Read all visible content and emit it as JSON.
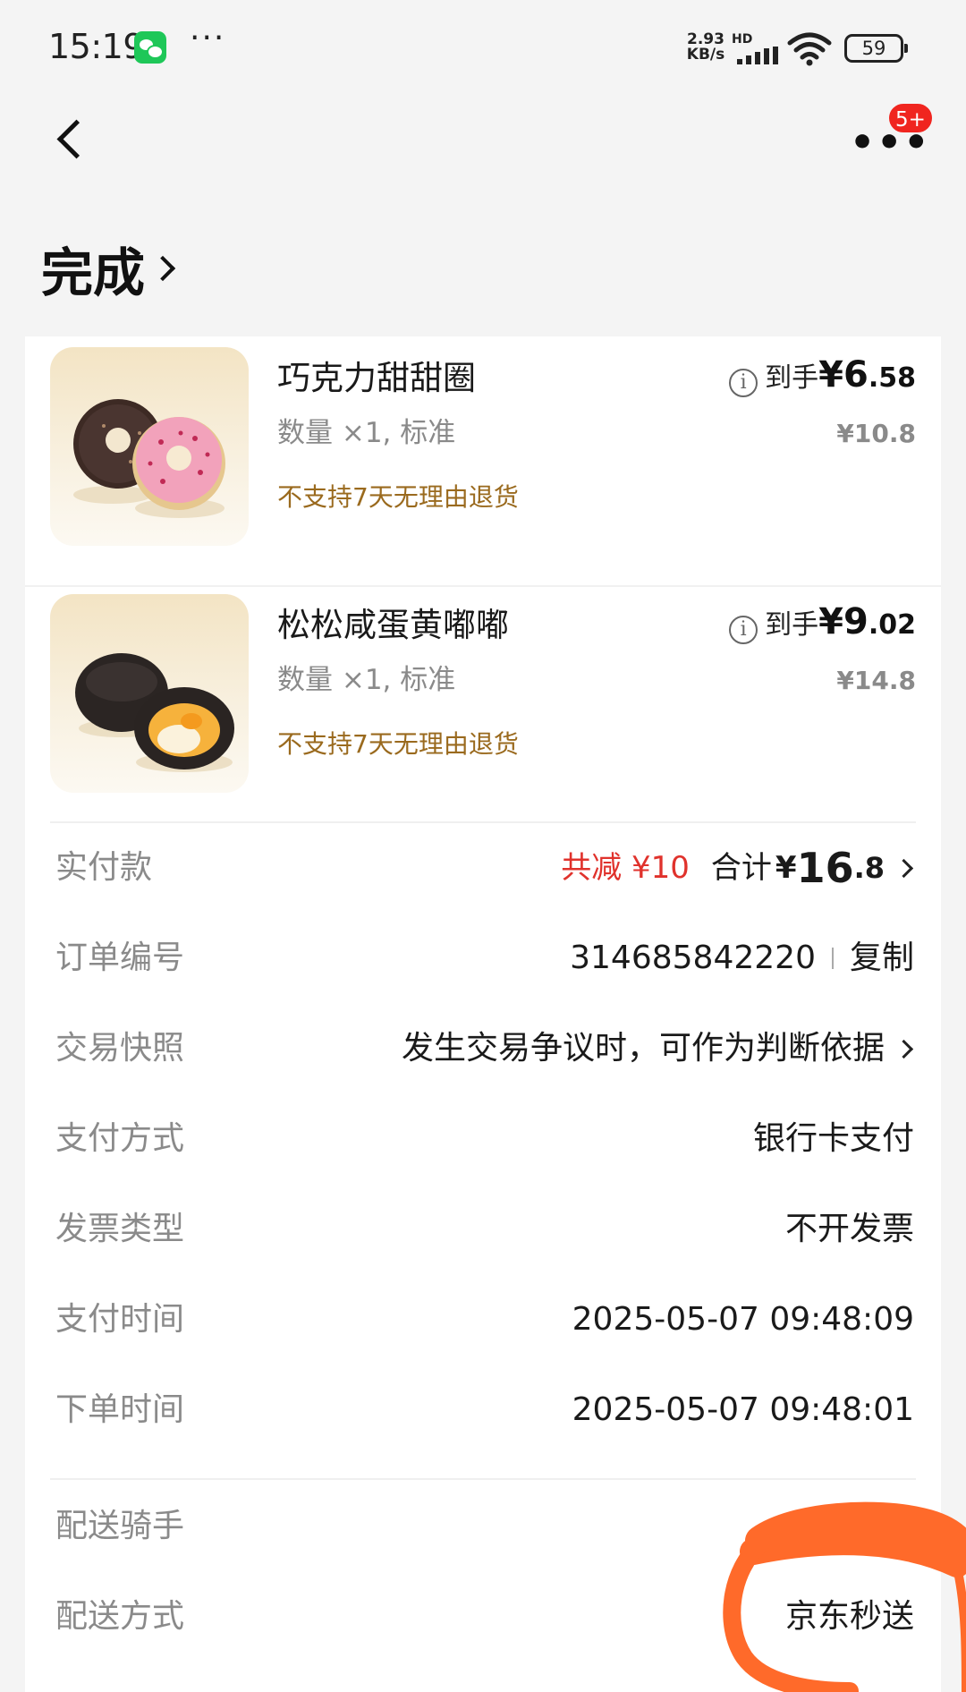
{
  "status_bar": {
    "time": "15:19",
    "speed": "2.93 KB/s",
    "network": "HD",
    "battery": "59",
    "icons": [
      "wechat-icon",
      "more-dots-icon",
      "signal-icon",
      "wifi-icon",
      "battery-icon"
    ]
  },
  "nav": {
    "more_label": "•••",
    "badge": "5+",
    "icons": [
      "back-arrow-icon",
      "more-icon"
    ]
  },
  "order": {
    "status": "完成"
  },
  "products": [
    {
      "name": "巧克力甜甜圈",
      "spec": "数量 ×1, 标准",
      "note": "不支持7天无理由退货",
      "price_label": "到手",
      "price_int": "¥6",
      "price_dec": ".58",
      "original_price": "¥10.8"
    },
    {
      "name": "松松咸蛋黄嘟嘟",
      "spec": "数量 ×1, 标准",
      "note": "不支持7天无理由退货",
      "price_label": "到手",
      "price_int": "¥9",
      "price_dec": ".02",
      "original_price": "¥14.8"
    }
  ],
  "payment": {
    "label": "实付款",
    "discount": "共减 ¥10",
    "total_label": "合计",
    "total_yen": "¥",
    "total_int": "16",
    "total_dec": ".8"
  },
  "details": {
    "order_no_label": "订单编号",
    "order_no": "314685842220",
    "copy": "复制",
    "snapshot_label": "交易快照",
    "snapshot_value": "发生交易争议时，可作为判断依据",
    "pay_method_label": "支付方式",
    "pay_method": "银行卡支付",
    "invoice_label": "发票类型",
    "invoice": "不开发票",
    "pay_time_label": "支付时间",
    "pay_time": "2025-05-07 09:48:09",
    "order_time_label": "下单时间",
    "order_time": "2025-05-07 09:48:01"
  },
  "delivery": {
    "rider_label": "配送骑手",
    "method_label": "配送方式",
    "method": "京东秒送"
  },
  "colors": {
    "background": "#f4f4f4",
    "discount_red": "#e0322c",
    "note_brown": "#9a6a1e",
    "badge_red": "#f0251f",
    "scribble_orange": "#ff6a2a"
  }
}
